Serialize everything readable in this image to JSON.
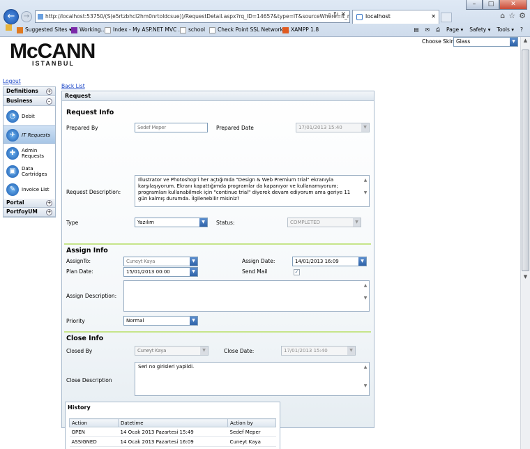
{
  "browser": {
    "address": "http://localhost:53750/(S(e5rtzbhcl2hm0nrtoldcsue))/RequestDetail.aspx?rq_ID=14657&type=IT&sourceWhere=it_rt_Group=",
    "tab_title": "localhost",
    "favorites": [
      "Suggested Sites ▾",
      "Working...",
      "Index - My ASP.NET MVC ...",
      "school",
      "Check Point SSL Network ...",
      "XAMPP 1.8"
    ],
    "commands": [
      "Page ▾",
      "Safety ▾",
      "Tools ▾"
    ],
    "window_buttons": [
      "–",
      "□",
      "✕"
    ]
  },
  "header": {
    "logo": "McCANN",
    "logo_sub": "ISTANBUL",
    "skin_label": "Choose Skin:",
    "skin_value": "Glass",
    "logout": "Logout",
    "back_list": "Back List"
  },
  "sidebar": {
    "panels": [
      {
        "label": "Definitions",
        "toggle": "+"
      },
      {
        "label": "Business",
        "toggle": "–"
      },
      {
        "label": "Portal",
        "toggle": "+"
      },
      {
        "label": "PortfoyUM",
        "toggle": "+"
      }
    ],
    "items": [
      {
        "label": "Debit",
        "icon": "debit-icon",
        "glyph": "◔"
      },
      {
        "label": "IT Requests",
        "icon": "it-requests-icon",
        "glyph": "✈"
      },
      {
        "label": "Admin Requests",
        "icon": "admin-requests-icon",
        "glyph": "✚"
      },
      {
        "label": "Data Cartridges",
        "icon": "data-cartridges-icon",
        "glyph": "▣"
      },
      {
        "label": "Invoice List",
        "icon": "invoice-list-icon",
        "glyph": "✎"
      }
    ]
  },
  "request": {
    "panel_title": "Request",
    "info_title": "Request Info",
    "prepared_by_label": "Prepared By",
    "prepared_by_value": "Sedef Meper",
    "prepared_date_label": "Prepared Date",
    "prepared_date_value": "17/01/2013 15:40",
    "description_label": "Request Description:",
    "description_value": "Illustrator ve Photoshop'i her açtığımda \"Design & Web Premium trial\" ekranıyla karşılaşıyorum. Ekranı kapattığımda programlar da kapanıyor ve kullanamıyorum; programları kullanabilmek için \"continue trial\" diyerek devam ediyorum ama geriye 11 gün kalmış durumda. İlgilenebilir misiniz?",
    "type_label": "Type",
    "type_value": "Yazılım",
    "status_label": "Status:",
    "status_value": "COMPLETED"
  },
  "assign": {
    "title": "Assign Info",
    "assign_to_label": "AssignTo:",
    "assign_to_value": "Cuneyt Kaya",
    "assign_date_label": "Assign Date:",
    "assign_date_value": "14/01/2013 16:09",
    "plan_date_label": "Plan Date:",
    "plan_date_value": "15/01/2013 00:00",
    "send_mail_label": "Send Mail",
    "send_mail_checked": "✓",
    "description_label": "Assign Description:",
    "priority_label": "Priority",
    "priority_value": "Normal"
  },
  "close": {
    "title": "Close Info",
    "closed_by_label": "Closed By",
    "closed_by_value": "Cuneyt Kaya",
    "closed_date_label": "Close Date:",
    "closed_date_value": "17/01/2013 15:40",
    "description_label": "Close Description",
    "description_value": "Seri no girisleri yapildi."
  },
  "history": {
    "title": "History",
    "columns": [
      "Action",
      "Datetime",
      "Action by"
    ],
    "rows": [
      [
        "OPEN",
        "14 Ocak 2013 Pazartesi 15:49",
        "Sedef Meper"
      ],
      [
        "ASSIGNED",
        "14 Ocak 2013 Pazartesi 16:09",
        "Cuneyt Kaya"
      ]
    ]
  },
  "colors": {
    "accent": "#2f63a8",
    "separator": "#c6e58a",
    "link": "#1a45c8"
  }
}
